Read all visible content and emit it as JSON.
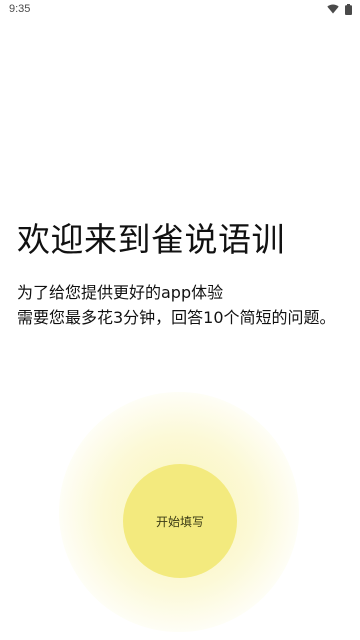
{
  "status_bar": {
    "time": "9:35",
    "icons": [
      "wifi-icon",
      "battery-icon"
    ]
  },
  "welcome": {
    "title": "欢迎来到雀说语训",
    "line1": "为了给您提供更好的app体验",
    "line2": "需要您最多花3分钟，回答10个简短的问题。"
  },
  "start_button": {
    "label": "开始填写",
    "color": "#f3ea7e"
  }
}
